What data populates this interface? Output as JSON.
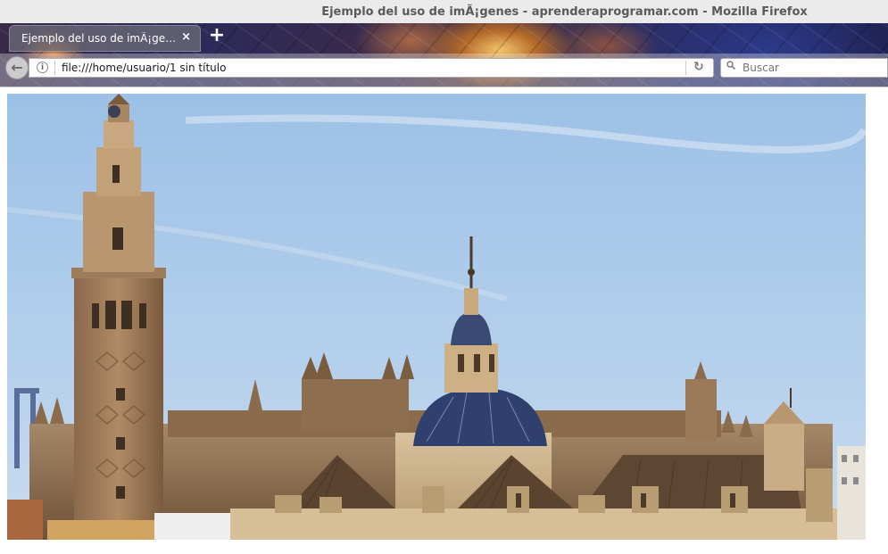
{
  "window": {
    "title": "Ejemplo del uso de imÃ¡genes - aprenderaprogramar.com - Mozilla Firefox"
  },
  "tab": {
    "label": "Ejemplo del uso de imÃ¡ge…",
    "close_glyph": "×"
  },
  "new_tab_glyph": "+",
  "navbar": {
    "back_glyph": "←",
    "info_glyph": "i",
    "url": "file:///home/usuario/1 sin título",
    "reload_glyph": "↻",
    "search_placeholder": "Buscar"
  },
  "page": {
    "image_subject": "seville-cathedral-giralda-photo"
  }
}
